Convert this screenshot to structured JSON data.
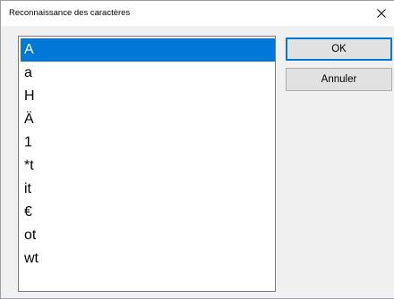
{
  "window": {
    "title": "Reconnaissance des caractères"
  },
  "list": {
    "selected_index": 0,
    "items": [
      "A",
      "a",
      "H",
      "Ä",
      "1",
      "*t",
      "it",
      "€",
      "ot",
      "wt"
    ]
  },
  "buttons": {
    "ok_label": "OK",
    "cancel_label": "Annuler"
  },
  "colors": {
    "selection": "#0078d7",
    "default_button_border": "#0078d7"
  },
  "icons": {
    "close": "close-icon"
  }
}
